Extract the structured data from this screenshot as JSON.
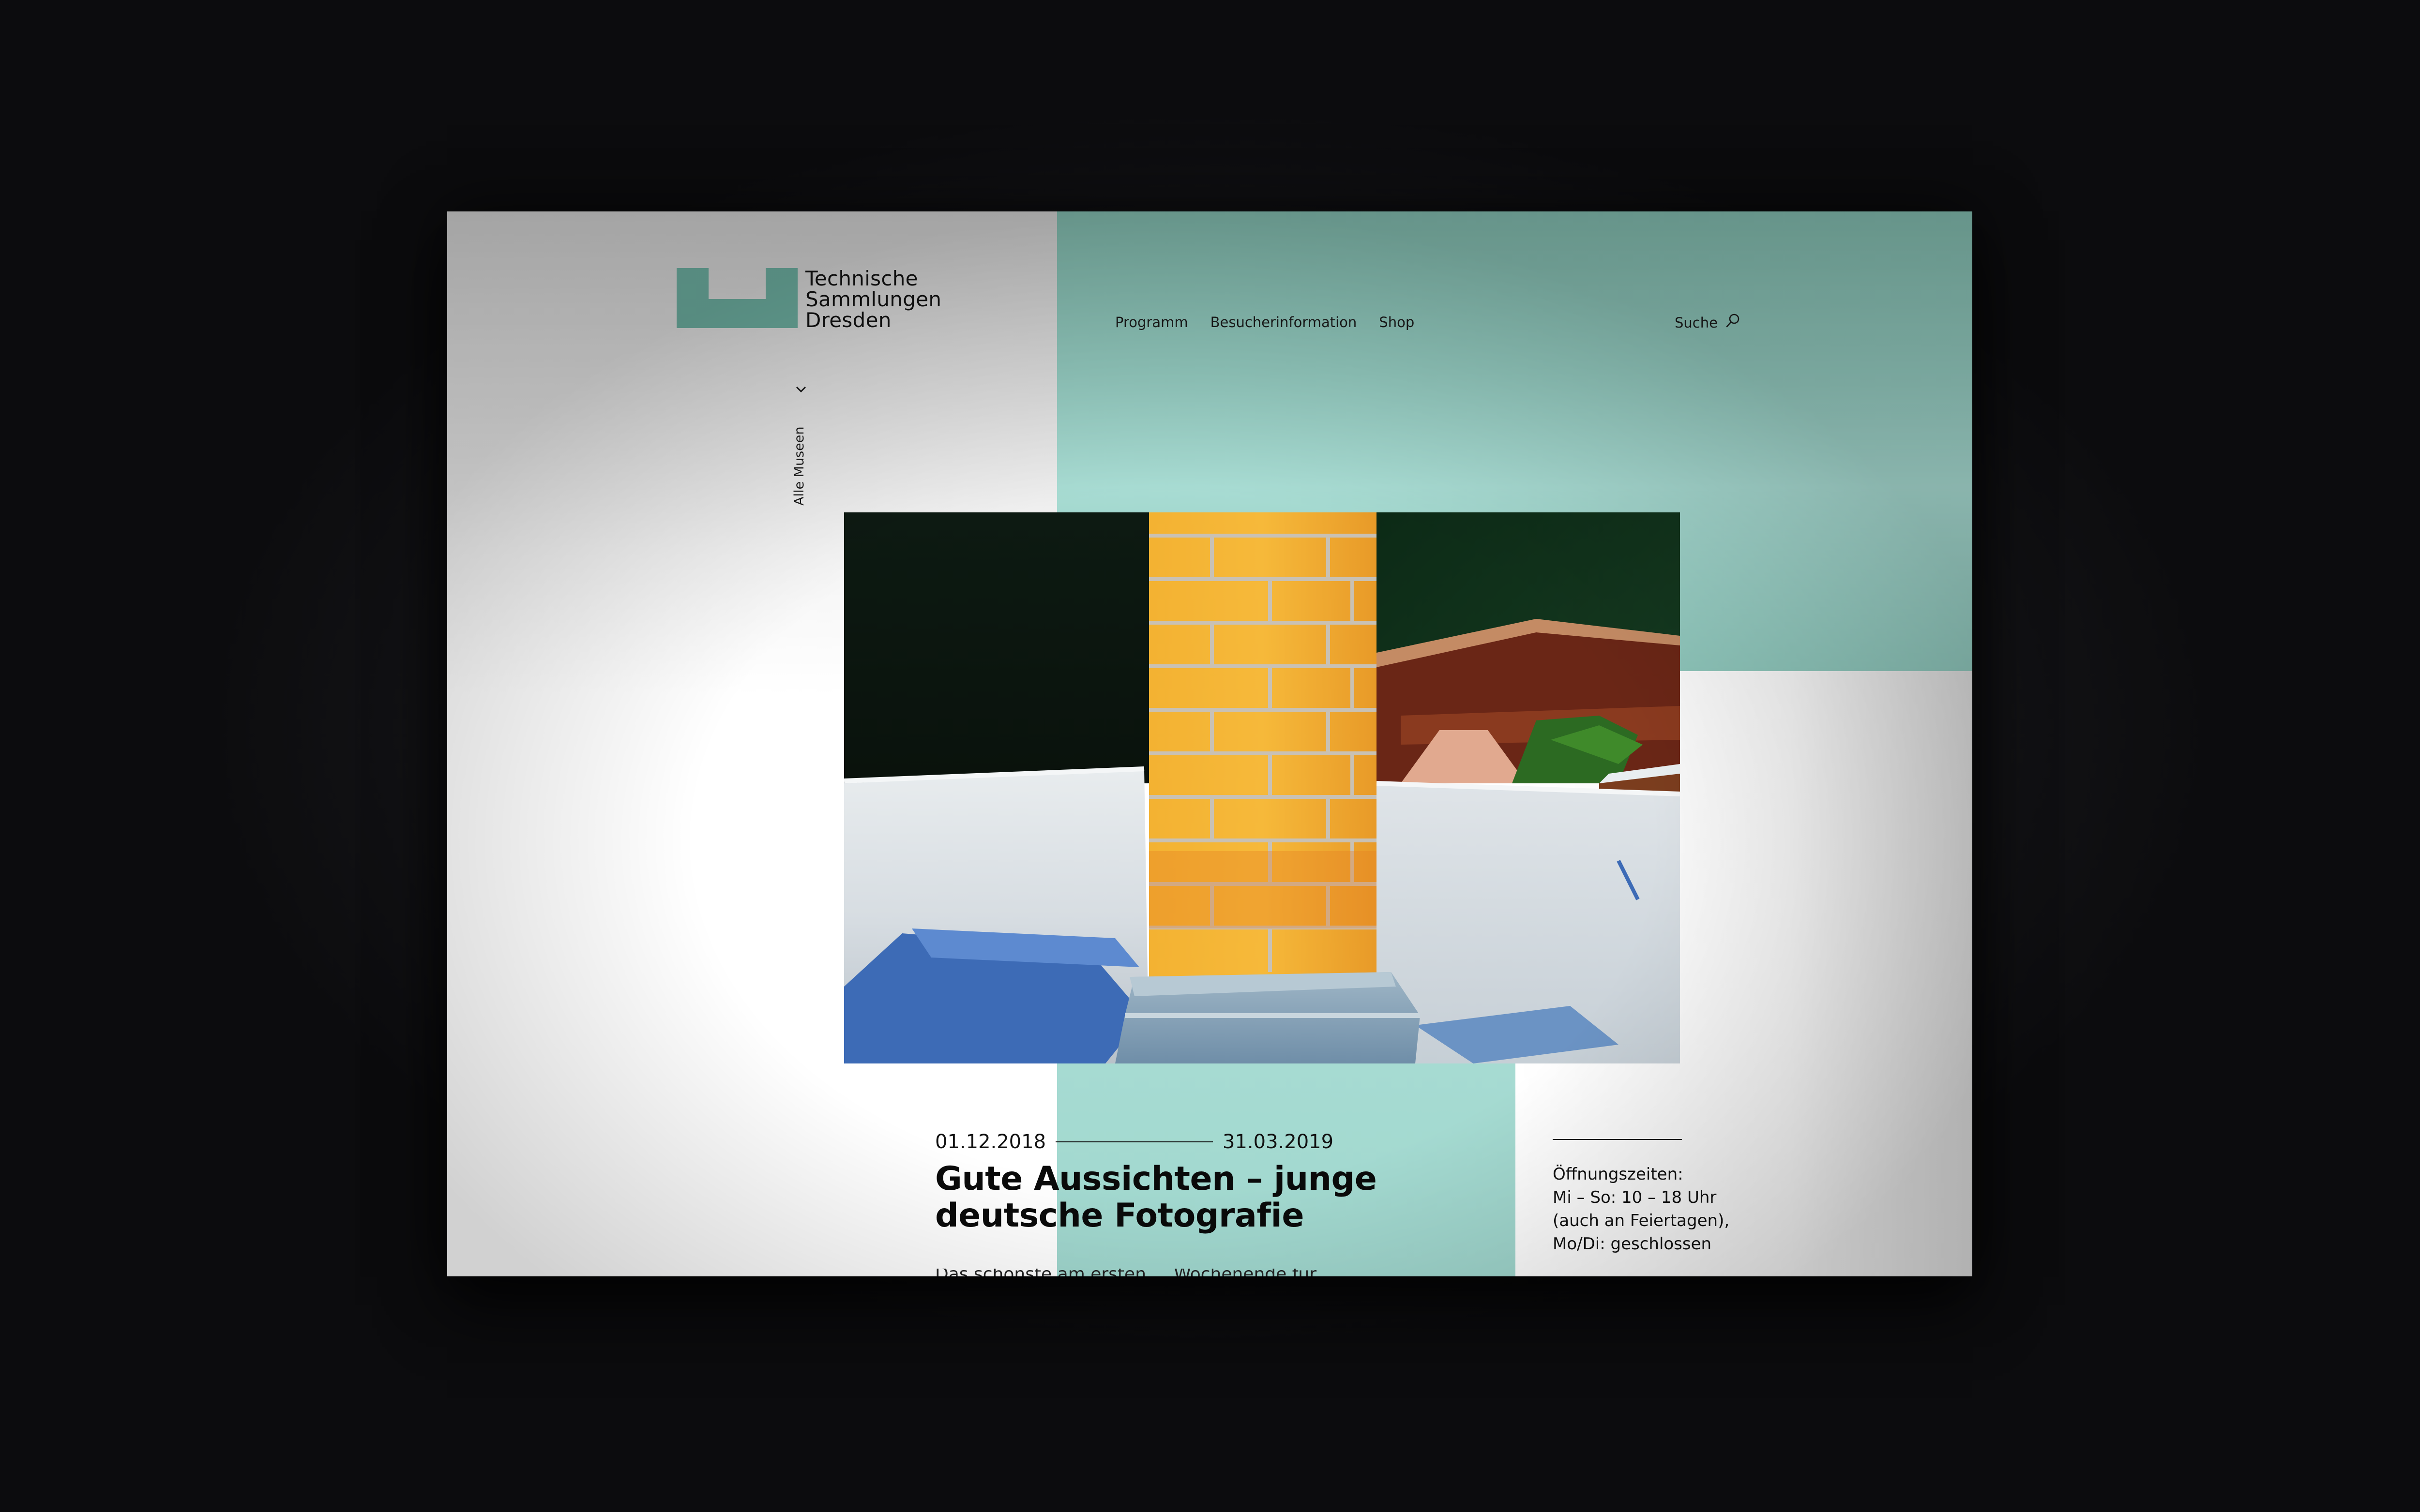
{
  "brand": {
    "name_lines": [
      "Technische",
      "Sammlungen",
      "Dresden"
    ],
    "logo_color": "#6aaa9c"
  },
  "nav": {
    "items": [
      "Programm",
      "Besucherinformation",
      "Shop"
    ],
    "search_label": "Suche"
  },
  "museums_toggle": {
    "label": "Alle Museen"
  },
  "exhibition": {
    "date_start": "01.12.2018",
    "date_end": "31.03.2019",
    "title_line1": "Gute Aussichten – junge",
    "title_line2": "deutsche Fotografie",
    "teaser": "Das schönste am ersten ... Wochenende für ..."
  },
  "opening_hours": {
    "heading": "Öffnungszeiten:",
    "line1": "Mi – So: 10 – 18 Uhr",
    "line2": "(auch an Feiertagen),",
    "line3": "Mo/Di: geschlossen"
  },
  "colors": {
    "teal": "#a6dbd2",
    "teal_dark": "#7db5a8",
    "text": "#111111"
  }
}
